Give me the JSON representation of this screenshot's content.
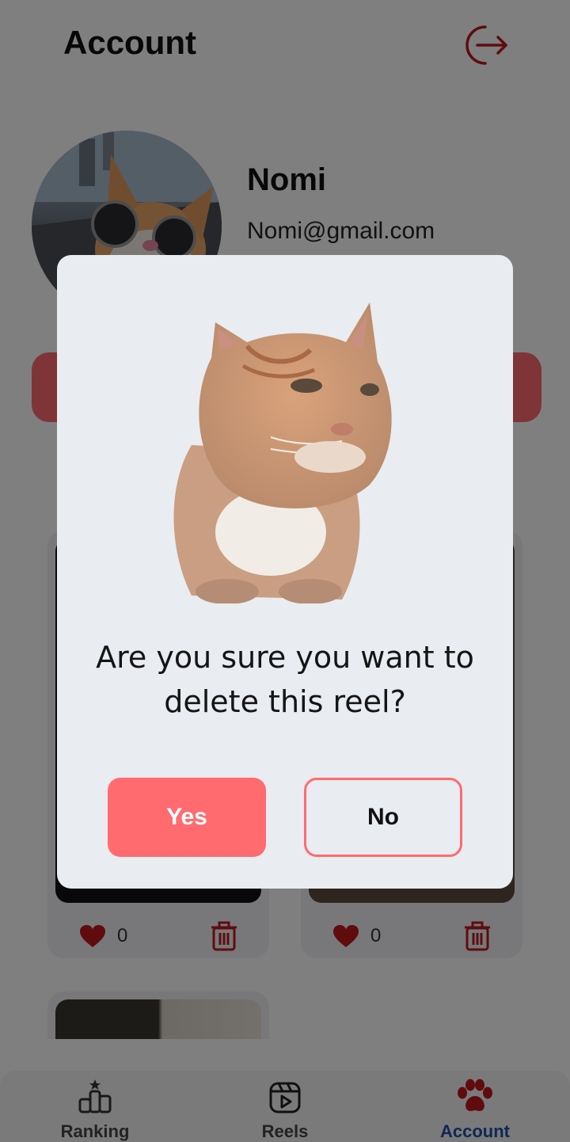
{
  "header": {
    "title": "Account",
    "logout_icon": "logout-icon"
  },
  "profile": {
    "name": "Nomi",
    "email": "Nomi@gmail.com",
    "avatar_icon": "cat-avatar"
  },
  "reels": [
    {
      "likes": "0",
      "like_icon": "heart-icon",
      "delete_icon": "trash-icon"
    },
    {
      "likes": "0",
      "like_icon": "heart-icon",
      "delete_icon": "trash-icon"
    }
  ],
  "dialog": {
    "image": "cat-image",
    "message": "Are you sure you want to delete this reel?",
    "yes_label": "Yes",
    "no_label": "No"
  },
  "nav": [
    {
      "label": "Ranking",
      "icon": "ranking-icon"
    },
    {
      "label": "Reels",
      "icon": "reels-icon"
    },
    {
      "label": "Account",
      "icon": "paw-icon",
      "active": true
    }
  ],
  "colors": {
    "accent": "#ff6b6f",
    "active_nav": "#1f4ea8",
    "icon_red": "#c0191f"
  }
}
